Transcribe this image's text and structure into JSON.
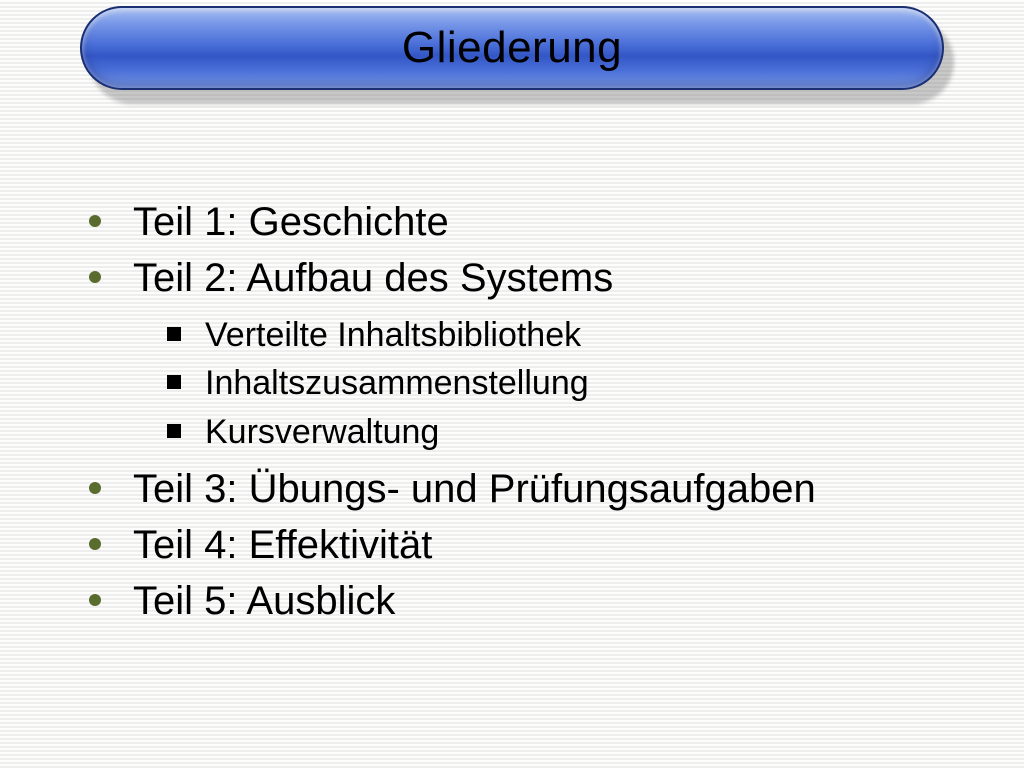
{
  "title": "Gliederung",
  "outline": {
    "items": [
      {
        "text": "Teil 1: Geschichte"
      },
      {
        "text": "Teil 2: Aufbau des Systems",
        "subs": [
          "Verteilte Inhaltsbibliothek",
          "Inhaltszusammenstellung",
          "Kursverwaltung"
        ]
      },
      {
        "text": "Teil 3: Übungs- und Prüfungsaufgaben"
      },
      {
        "text": "Teil 4: Effektivität"
      },
      {
        "text": "Teil 5: Ausblick"
      }
    ]
  }
}
